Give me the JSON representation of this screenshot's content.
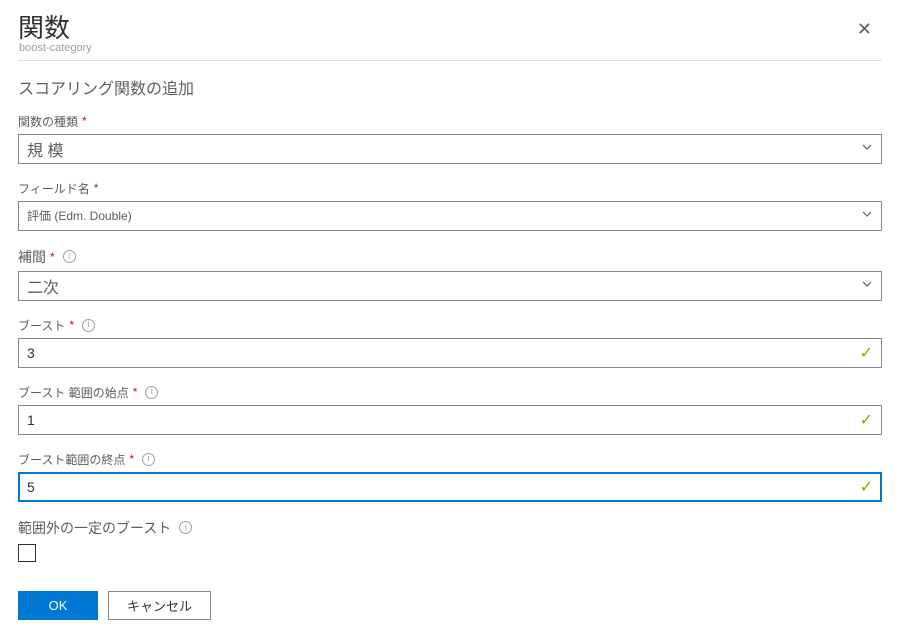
{
  "header": {
    "title": "関数",
    "subtitle": "boost-category"
  },
  "section_title": "スコアリング関数の追加",
  "fields": {
    "function_type": {
      "label": "関数の種類",
      "value": "規 模"
    },
    "field_name": {
      "label": "フィールド名",
      "value": "評価 (Edm. Double)"
    },
    "interpolation": {
      "label": "補間",
      "value": "二次"
    },
    "boost": {
      "label": "ブースト",
      "value": "3"
    },
    "boost_range_start": {
      "label": "ブースト 範囲の始点",
      "value": "1"
    },
    "boost_range_end": {
      "label": "ブースト範囲の終点",
      "value": "5"
    },
    "constant_boost_outside": {
      "label": "範囲外の一定のブースト"
    }
  },
  "buttons": {
    "ok": "OK",
    "cancel": "キャンセル"
  },
  "icons": {
    "required": "*",
    "info": "i"
  }
}
